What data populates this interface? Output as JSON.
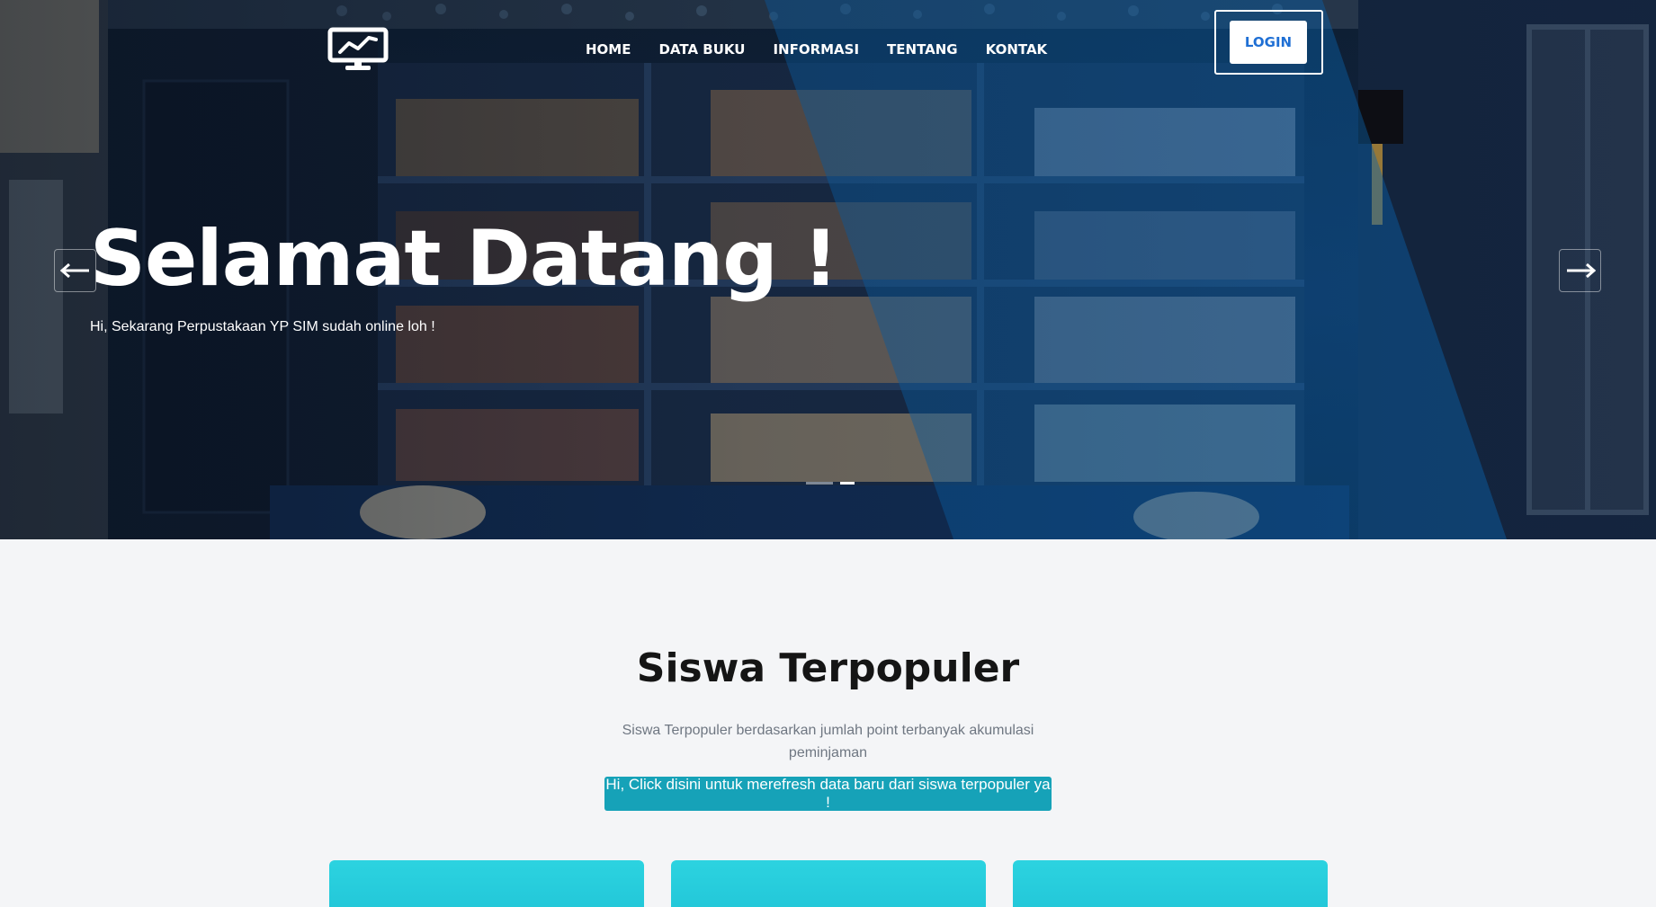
{
  "header": {
    "logo_icon": "monitor-chart-icon",
    "nav": [
      {
        "label": "HOME"
      },
      {
        "label": "DATA BUKU"
      },
      {
        "label": "INFORMASI"
      },
      {
        "label": "TENTANG"
      },
      {
        "label": "KONTAK"
      }
    ],
    "login_label": "LOGIN"
  },
  "hero": {
    "title": "Selamat Datang !",
    "subtitle": "Hi, Sekarang Perpustakaan YP SIM sudah online loh !",
    "prev_icon": "arrow-left-icon",
    "next_icon": "arrow-right-icon",
    "slides_count": 2,
    "active_slide": 2
  },
  "section": {
    "title": "Siswa Terpopuler",
    "description": "Siswa Terpopuler berdasarkan jumlah point terbanyak akumulasi peminjaman",
    "refresh_button": "Hi, Click disini untuk merefresh data baru dari siswa terpopuler ya !"
  },
  "colors": {
    "accent_blue": "#1f6fd4",
    "refresh_button": "#16a2b8",
    "card": "#2cd3e0",
    "page_background": "#f4f5f7"
  }
}
